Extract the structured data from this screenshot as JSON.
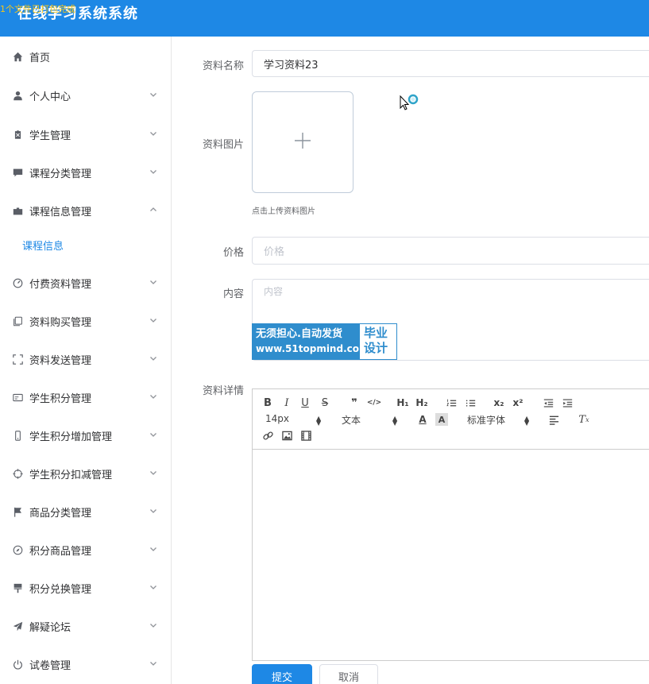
{
  "header": {
    "title": "在线学习系统系统",
    "overlay_text": "1个文件已打包完成"
  },
  "sidebar": {
    "items": [
      {
        "label": "首页",
        "icon": "home-icon",
        "expandable": false
      },
      {
        "label": "个人中心",
        "icon": "user-icon",
        "expandable": true
      },
      {
        "label": "学生管理",
        "icon": "clipboard-icon",
        "expandable": true
      },
      {
        "label": "课程分类管理",
        "icon": "chat-icon",
        "expandable": true
      },
      {
        "label": "课程信息管理",
        "icon": "folder-icon",
        "expandable": true,
        "expanded": true
      },
      {
        "label": "付费资料管理",
        "icon": "dashboard-icon",
        "expandable": true
      },
      {
        "label": "资料购买管理",
        "icon": "copy-icon",
        "expandable": true
      },
      {
        "label": "资料发送管理",
        "icon": "fullscreen-icon",
        "expandable": true
      },
      {
        "label": "学生积分管理",
        "icon": "card-icon",
        "expandable": true
      },
      {
        "label": "学生积分增加管理",
        "icon": "mobile-icon",
        "expandable": true
      },
      {
        "label": "学生积分扣减管理",
        "icon": "target-icon",
        "expandable": true
      },
      {
        "label": "商品分类管理",
        "icon": "flag-icon",
        "expandable": true
      },
      {
        "label": "积分商品管理",
        "icon": "compass-icon",
        "expandable": true
      },
      {
        "label": "积分兑换管理",
        "icon": "brush-icon",
        "expandable": true
      },
      {
        "label": "解疑论坛",
        "icon": "send-icon",
        "expandable": true
      },
      {
        "label": "试卷管理",
        "icon": "power-icon",
        "expandable": true
      }
    ],
    "submenu": {
      "label": "课程信息"
    }
  },
  "form": {
    "name_label": "资料名称",
    "name_value": "学习资料23",
    "image_label": "资料图片",
    "upload_tip": "点击上传资料图片",
    "price_label": "价格",
    "price_placeholder": "价格",
    "content_label": "内容",
    "content_placeholder": "内容",
    "detail_label": "资料详情",
    "submit_label": "提交",
    "cancel_label": "取消"
  },
  "watermark": {
    "line1": "无须担心.自动发货",
    "line2": "www.51topmind.com",
    "right1": "毕业",
    "right2": "设计"
  },
  "editor": {
    "size_picker": "14px",
    "header_picker": "文本",
    "font_picker": "标准字体",
    "h1": "H₁",
    "h2": "H₂",
    "sub": "x₂",
    "sup": "x²",
    "quote": "❞",
    "code": "</>"
  },
  "colors": {
    "primary": "#1e88e5",
    "watermark": "#2f8dcd",
    "overlay_text": "#f5c518"
  }
}
